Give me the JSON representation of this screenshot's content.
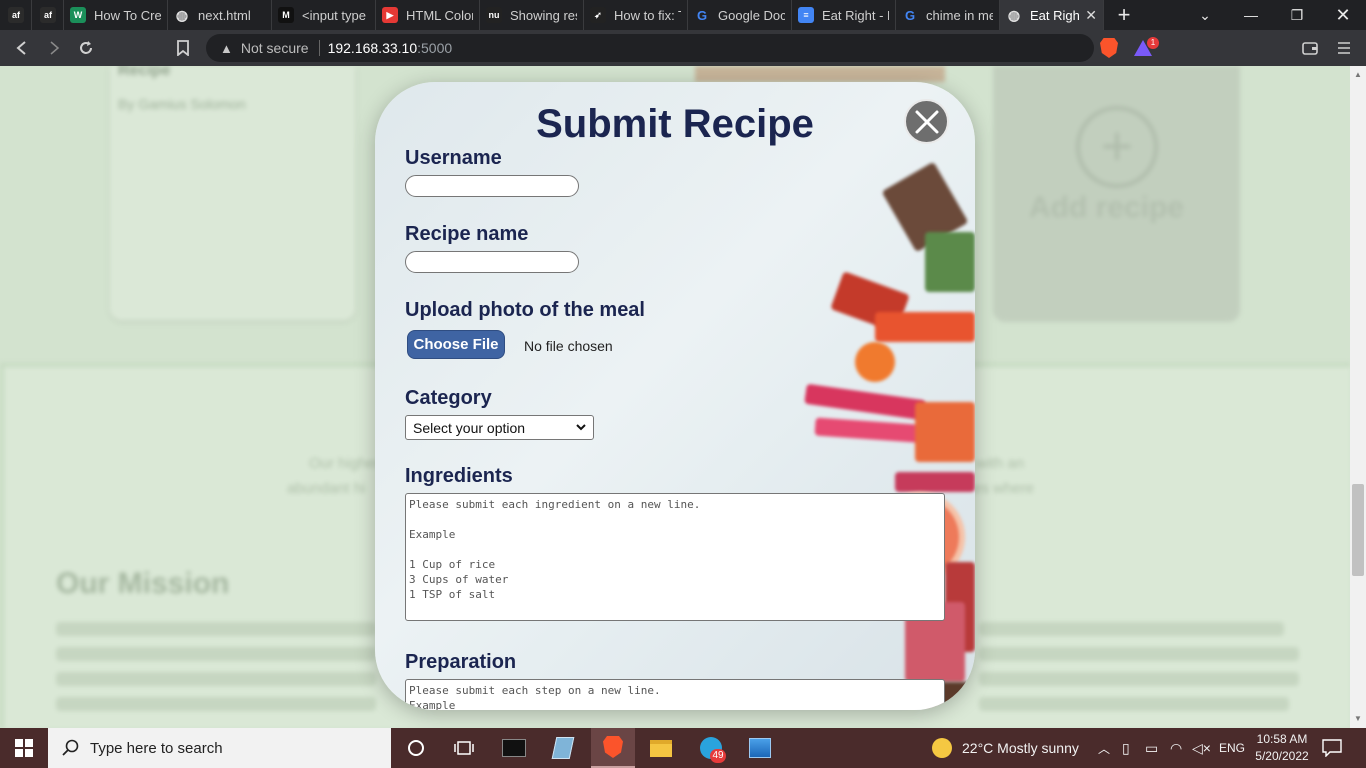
{
  "browser": {
    "tabs": [
      {
        "title": "",
        "favicon": "af",
        "color": "#2b2b2b"
      },
      {
        "title": "",
        "favicon": "af",
        "color": "#2b2b2b"
      },
      {
        "title": "How To Crea",
        "favicon": "W",
        "color": "#1b8f5a"
      },
      {
        "title": "next.html",
        "favicon": "globe",
        "color": "#5f6368"
      },
      {
        "title": "<input type",
        "favicon": "M",
        "color": "#111111"
      },
      {
        "title": "HTML Color",
        "favicon": "play",
        "color": "#e53935"
      },
      {
        "title": "Showing res",
        "favicon": "nu",
        "color": "#222222"
      },
      {
        "title": "How to fix: T",
        "favicon": "rocket",
        "color": "#222222"
      },
      {
        "title": "Google Docs",
        "favicon": "G",
        "color": "#ffffff"
      },
      {
        "title": "Eat Right - M",
        "favicon": "doc",
        "color": "#4285f4"
      },
      {
        "title": "chime in me",
        "favicon": "G",
        "color": "#ffffff"
      },
      {
        "title": "Eat Righ",
        "favicon": "globe",
        "color": "#5f6368",
        "active": true
      }
    ],
    "new_tab": "+",
    "address": {
      "security": "Not secure",
      "host": "192.168.33.10",
      "port": ":5000"
    },
    "rewards_badge": "1"
  },
  "background_page": {
    "card_author": "By Gamius Solomon",
    "card_name": "Recipe",
    "add_recipe": "Add recipe",
    "band_line_left_1": "Our higher",
    "band_line_left_2": "abundant hi",
    "band_line_right_1": "o with an",
    "band_line_right_2": "lives where",
    "mission_heading": "Our Mission"
  },
  "modal": {
    "title": "Submit Recipe",
    "close_icon": "close-icon",
    "username_label": "Username",
    "username_value": "",
    "recipe_name_label": "Recipe name",
    "recipe_name_value": "",
    "photo_label": "Upload photo of the meal",
    "file_button": "Choose File",
    "file_status": "No file chosen",
    "category_label": "Category",
    "category_selected": "Select your option",
    "ingredients_label": "Ingredients",
    "ingredients_placeholder": "Please submit each ingredient on a new line.\n\nExample\n\n1 Cup of rice\n3 Cups of water\n1 TSP of salt",
    "preparation_label": "Preparation",
    "preparation_placeholder": "Please submit each step on a new line.\nExample"
  },
  "taskbar": {
    "search_placeholder": "Type here to search",
    "weather": "22°C  Mostly sunny",
    "language": "ENG",
    "time": "10:58 AM",
    "date": "5/20/2022",
    "telegram_badge": "49"
  }
}
